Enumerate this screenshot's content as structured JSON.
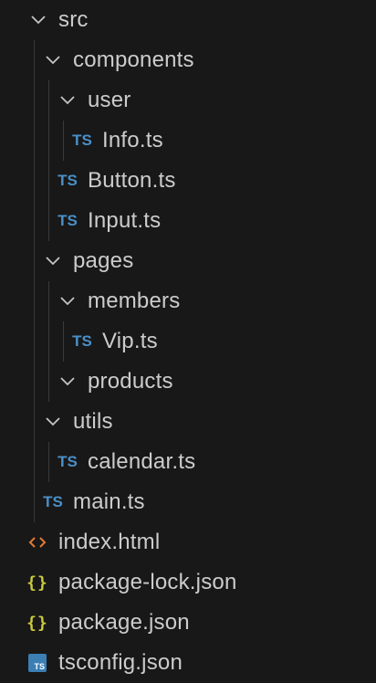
{
  "explorer": {
    "items": [
      {
        "label": "src",
        "icon": "chevron-down-icon",
        "kind": "folder"
      },
      {
        "label": "components",
        "icon": "chevron-down-icon",
        "kind": "folder"
      },
      {
        "label": "user",
        "icon": "chevron-down-icon",
        "kind": "folder"
      },
      {
        "label": "Info.ts",
        "icon": "typescript-file-icon",
        "icon_text": "TS",
        "kind": "file"
      },
      {
        "label": "Button.ts",
        "icon": "typescript-file-icon",
        "icon_text": "TS",
        "kind": "file"
      },
      {
        "label": "Input.ts",
        "icon": "typescript-file-icon",
        "icon_text": "TS",
        "kind": "file"
      },
      {
        "label": "pages",
        "icon": "chevron-down-icon",
        "kind": "folder"
      },
      {
        "label": "members",
        "icon": "chevron-down-icon",
        "kind": "folder"
      },
      {
        "label": "Vip.ts",
        "icon": "typescript-file-icon",
        "icon_text": "TS",
        "kind": "file"
      },
      {
        "label": "products",
        "icon": "chevron-down-icon",
        "kind": "folder"
      },
      {
        "label": "utils",
        "icon": "chevron-down-icon",
        "kind": "folder"
      },
      {
        "label": "calendar.ts",
        "icon": "typescript-file-icon",
        "icon_text": "TS",
        "kind": "file"
      },
      {
        "label": "main.ts",
        "icon": "typescript-file-icon",
        "icon_text": "TS",
        "kind": "file"
      },
      {
        "label": "index.html",
        "icon": "html-file-icon",
        "kind": "file"
      },
      {
        "label": "package-lock.json",
        "icon": "json-file-icon",
        "icon_text": "{}",
        "kind": "file"
      },
      {
        "label": "package.json",
        "icon": "json-file-icon",
        "icon_text": "{}",
        "kind": "file"
      },
      {
        "label": "tsconfig.json",
        "icon": "tsconfig-file-icon",
        "icon_text": "TS",
        "kind": "file"
      }
    ]
  },
  "colors": {
    "background": "#181818",
    "text": "#cccccc",
    "chevron": "#c5c5c5",
    "ts_icon": "#4a90c8",
    "html_icon": "#e37933",
    "json_icon": "#cbcb41",
    "tsconfig_icon": "#3b7fb5",
    "indent_guide": "#3a3a3a"
  }
}
